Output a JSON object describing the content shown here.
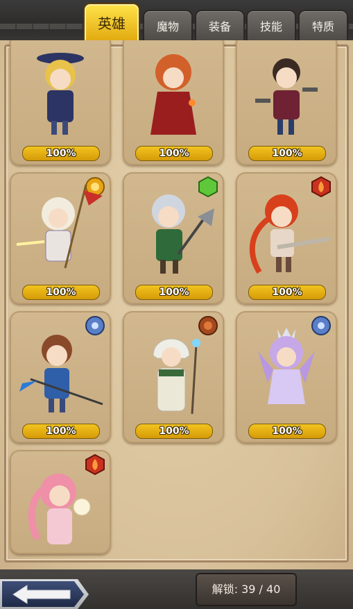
{
  "tabs": [
    {
      "label": "英雄",
      "active": true
    },
    {
      "label": "魔物",
      "active": false
    },
    {
      "label": "装备",
      "active": false
    },
    {
      "label": "技能",
      "active": false
    },
    {
      "label": "特质",
      "active": false
    }
  ],
  "heroes": [
    {
      "progress": "100%",
      "element": "none",
      "hair": "#e8c24a",
      "outfit": "#2c3463"
    },
    {
      "progress": "100%",
      "element": "none",
      "hair": "#d2602a",
      "outfit": "#9a1e1e"
    },
    {
      "progress": "100%",
      "element": "none",
      "hair": "#3b2a24",
      "outfit": "#6e2233"
    },
    {
      "progress": "100%",
      "element": "sun-gem-icon",
      "hair": "#f1ecdd",
      "outfit": "#e9e4e0"
    },
    {
      "progress": "100%",
      "element": "earth-gem-icon",
      "hair": "#cfd6e0",
      "outfit": "#2f6a3a"
    },
    {
      "progress": "100%",
      "element": "fire-gem-icon",
      "hair": "#d8401c",
      "outfit": "#e7d7c8"
    },
    {
      "progress": "100%",
      "element": "water-gem-icon",
      "hair": "#8a4a2a",
      "outfit": "#2f5fa8"
    },
    {
      "progress": "100%",
      "element": "wind-gem-icon",
      "hair": "#f0f0ee",
      "outfit": "#ece8d8"
    },
    {
      "progress": "100%",
      "element": "water-gem-icon",
      "hair": "#c6a7e8",
      "outfit": "#d8c8f4"
    },
    {
      "progress": null,
      "element": "fire-gem-icon",
      "hair": "#ef8fa8",
      "outfit": "#f4c9d4"
    }
  ],
  "unlock": {
    "label": "解锁: 39 / 40"
  }
}
